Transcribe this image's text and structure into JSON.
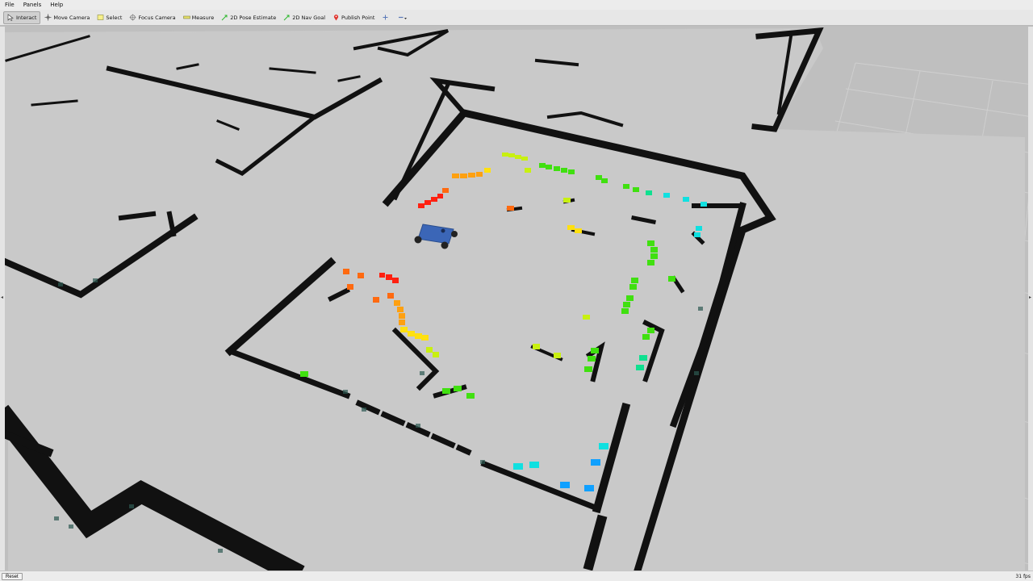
{
  "menu": {
    "file": "File",
    "panels": "Panels",
    "help": "Help"
  },
  "toolbar": {
    "interact": "Interact",
    "move_camera": "Move Camera",
    "select": "Select",
    "focus_camera": "Focus Camera",
    "measure": "Measure",
    "pose_estimate": "2D Pose Estimate",
    "nav_goal": "2D Nav Goal",
    "publish_point": "Publish Point"
  },
  "status": {
    "reset": "Reset",
    "fps": "31 fps"
  },
  "colors": {
    "background": "#bfbfbf",
    "free_space": "#c9c9c9",
    "wall": "#111111",
    "robot": "#3b66b7",
    "ground_grid": "#cdcdcd"
  }
}
